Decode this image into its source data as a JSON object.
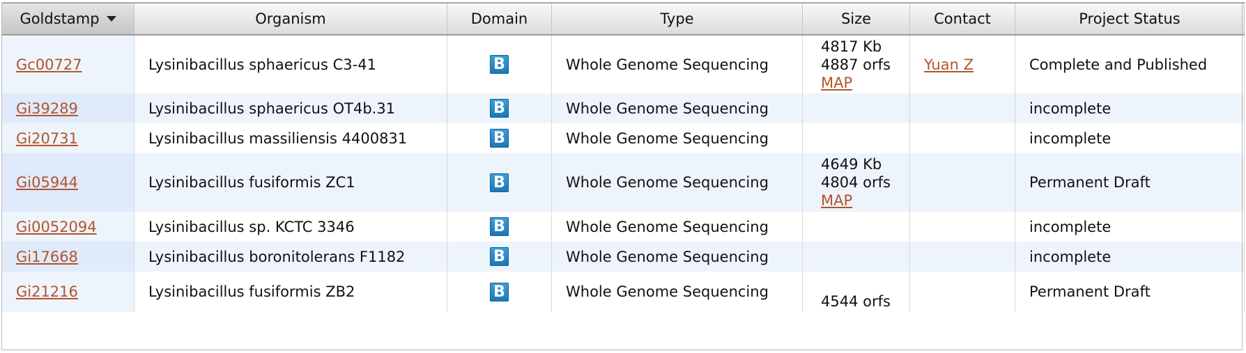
{
  "headers": {
    "goldstamp": "Goldstamp",
    "organism": "Organism",
    "domain": "Domain",
    "type": "Type",
    "size": "Size",
    "contact": "Contact",
    "status": "Project Status"
  },
  "domain_icon": "bacteria-domain-icon",
  "domain_badge_letter": "B",
  "rows": [
    {
      "goldstamp": "Gc00727",
      "organism": "Lysinibacillus sphaericus C3-41",
      "type": "Whole Genome Sequencing",
      "size_kb": "4817 Kb",
      "size_orfs": "4887 orfs",
      "size_map": "MAP",
      "contact": "Yuan Z",
      "status": "Complete and Published"
    },
    {
      "goldstamp": "Gi39289",
      "organism": "Lysinibacillus sphaericus OT4b.31",
      "type": "Whole Genome Sequencing",
      "size_kb": "",
      "size_orfs": "",
      "size_map": "",
      "contact": "",
      "status": "incomplete"
    },
    {
      "goldstamp": "Gi20731",
      "organism": "Lysinibacillus massiliensis 4400831",
      "type": "Whole Genome Sequencing",
      "size_kb": "",
      "size_orfs": "",
      "size_map": "",
      "contact": "",
      "status": "incomplete"
    },
    {
      "goldstamp": "Gi05944",
      "organism": "Lysinibacillus fusiformis ZC1",
      "type": "Whole Genome Sequencing",
      "size_kb": "4649 Kb",
      "size_orfs": "4804 orfs",
      "size_map": "MAP",
      "contact": "",
      "status": "Permanent Draft"
    },
    {
      "goldstamp": "Gi0052094",
      "organism": "Lysinibacillus sp. KCTC 3346",
      "type": "Whole Genome Sequencing",
      "size_kb": "",
      "size_orfs": "",
      "size_map": "",
      "contact": "",
      "status": "incomplete"
    },
    {
      "goldstamp": "Gi17668",
      "organism": "Lysinibacillus boronitolerans F1182",
      "type": "Whole Genome Sequencing",
      "size_kb": "",
      "size_orfs": "",
      "size_map": "",
      "contact": "",
      "status": "incomplete"
    },
    {
      "goldstamp": "Gi21216",
      "organism": "Lysinibacillus fusiformis ZB2",
      "type": "Whole Genome Sequencing",
      "size_kb": "",
      "size_orfs": "4544 orfs",
      "size_map": "",
      "contact": "",
      "status": "Permanent Draft"
    }
  ]
}
